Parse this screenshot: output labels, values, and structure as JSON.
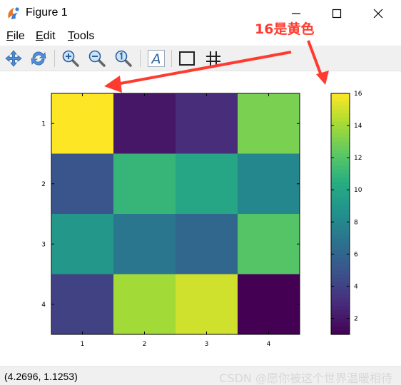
{
  "window": {
    "title": "Figure 1",
    "minimize_icon": "minimize-icon",
    "maximize_icon": "maximize-icon",
    "close_icon": "close-icon"
  },
  "menu": {
    "items": [
      {
        "label": "File",
        "accel": "F",
        "rest": "ile"
      },
      {
        "label": "Edit",
        "accel": "E",
        "rest": "dit"
      },
      {
        "label": "Tools",
        "accel": "T",
        "rest": "ools"
      }
    ]
  },
  "toolbar": {
    "buttons": [
      "pan-icon",
      "rotate-icon",
      "zoom-in-icon",
      "zoom-out-icon",
      "zoom-reset-icon",
      "text-annotation-icon",
      "axes-box-icon",
      "grid-icon"
    ],
    "text_button_glyph": "A"
  },
  "annotation": {
    "text": "16是黄色",
    "color": "#ff3b2f"
  },
  "chart_data": {
    "type": "heatmap",
    "colormap": "viridis",
    "rows": [
      1,
      2,
      3,
      4
    ],
    "cols": [
      1,
      2,
      3,
      4
    ],
    "values": [
      [
        16,
        2,
        3,
        13
      ],
      [
        5,
        11,
        10,
        8
      ],
      [
        9,
        7,
        6,
        12
      ],
      [
        4,
        14,
        15,
        1
      ]
    ],
    "xticks": [
      "1",
      "2",
      "3",
      "4"
    ],
    "yticks": [
      "1",
      "2",
      "3",
      "4"
    ],
    "colorbar": {
      "range": [
        1,
        16
      ],
      "ticks": [
        "2",
        "4",
        "6",
        "8",
        "10",
        "12",
        "14",
        "16"
      ]
    }
  },
  "status": {
    "coordinates": "(4.2696, 1.1253)",
    "watermark": "CSDN @愿你被这个世界温暖相待"
  }
}
